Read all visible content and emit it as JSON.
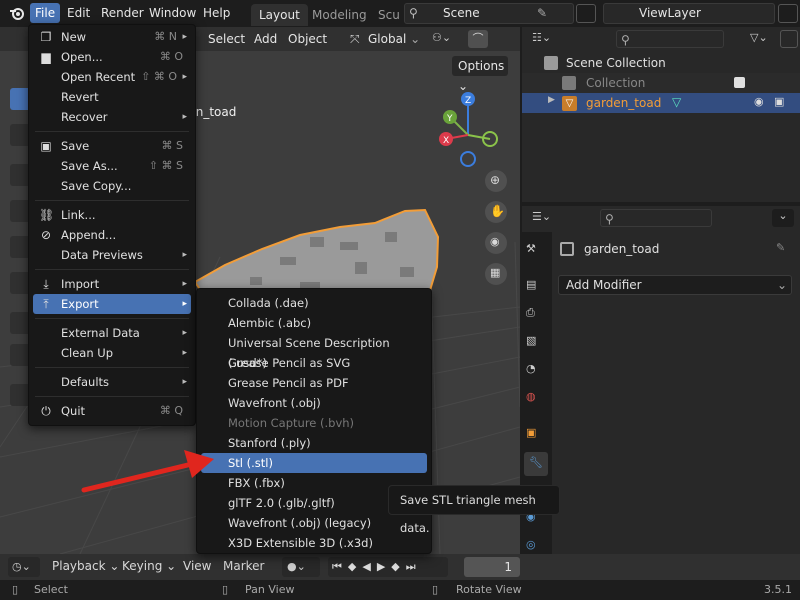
{
  "topbar": {
    "menus": [
      "File",
      "Edit",
      "Render",
      "Window",
      "Help"
    ],
    "workspace_tabs": [
      "Layout",
      "Modeling",
      "Scu"
    ],
    "scene_name": "Scene",
    "viewlayer_name": "ViewLayer"
  },
  "viewport_header": {
    "select": "Select",
    "add": "Add",
    "object": "Object",
    "orientation": "Global",
    "options": "Options"
  },
  "viewport": {
    "object_label": "rden_toad",
    "gizmo": {
      "x": "X",
      "y": "Y",
      "z": "Z"
    }
  },
  "file_menu": {
    "items": [
      {
        "label": "New",
        "shortcut": "⌘ N",
        "icon": "new-file-icon",
        "submenu": true
      },
      {
        "label": "Open...",
        "shortcut": "⌘ O",
        "icon": "folder-icon"
      },
      {
        "label": "Open Recent",
        "shortcut": "⇧ ⌘ O",
        "submenu": true
      },
      {
        "label": "Revert"
      },
      {
        "label": "Recover",
        "submenu": true
      },
      {
        "label": "Save",
        "shortcut": "⌘ S",
        "icon": "save-icon"
      },
      {
        "label": "Save As...",
        "shortcut": "⇧ ⌘ S"
      },
      {
        "label": "Save Copy..."
      },
      {
        "label": "Link...",
        "icon": "link-icon"
      },
      {
        "label": "Append...",
        "icon": "append-icon"
      },
      {
        "label": "Data Previews",
        "submenu": true
      },
      {
        "label": "Import",
        "icon": "import-icon",
        "submenu": true
      },
      {
        "label": "Export",
        "icon": "export-icon",
        "submenu": true
      },
      {
        "label": "External Data",
        "submenu": true
      },
      {
        "label": "Clean Up",
        "submenu": true
      },
      {
        "label": "Defaults",
        "submenu": true
      },
      {
        "label": "Quit",
        "shortcut": "⌘ Q",
        "icon": "power-icon"
      }
    ]
  },
  "export_menu": {
    "items": [
      "Collada (.dae)",
      "Alembic (.abc)",
      "Universal Scene Description (.usd*)",
      "Grease Pencil as SVG",
      "Grease Pencil as PDF",
      "Wavefront (.obj)",
      "Motion Capture (.bvh)",
      "Stanford (.ply)",
      "Stl (.stl)",
      "FBX (.fbx)",
      "glTF 2.0 (.glb/.gltf)",
      "Wavefront (.obj) (legacy)",
      "X3D Extensible 3D (.x3d)"
    ],
    "highlighted": "Stl (.stl)",
    "disabled": "Motion Capture (.bvh)"
  },
  "tooltip": "Save STL triangle mesh data.",
  "outliner": {
    "scene_collection": "Scene Collection",
    "collection": "Collection",
    "object": "garden_toad"
  },
  "properties": {
    "object_name": "garden_toad",
    "add_modifier": "Add Modifier"
  },
  "timeline": {
    "playback": "Playback",
    "keying": "Keying",
    "view": "View",
    "marker": "Marker",
    "frame": "1"
  },
  "statusbar": {
    "select": "Select",
    "pan_view": "Pan View",
    "rotate_view": "Rotate View",
    "version": "3.5.1"
  },
  "colors": {
    "accent": "#4772b3",
    "selection_outline": "#f29d38",
    "arrow": "#e0261e"
  }
}
